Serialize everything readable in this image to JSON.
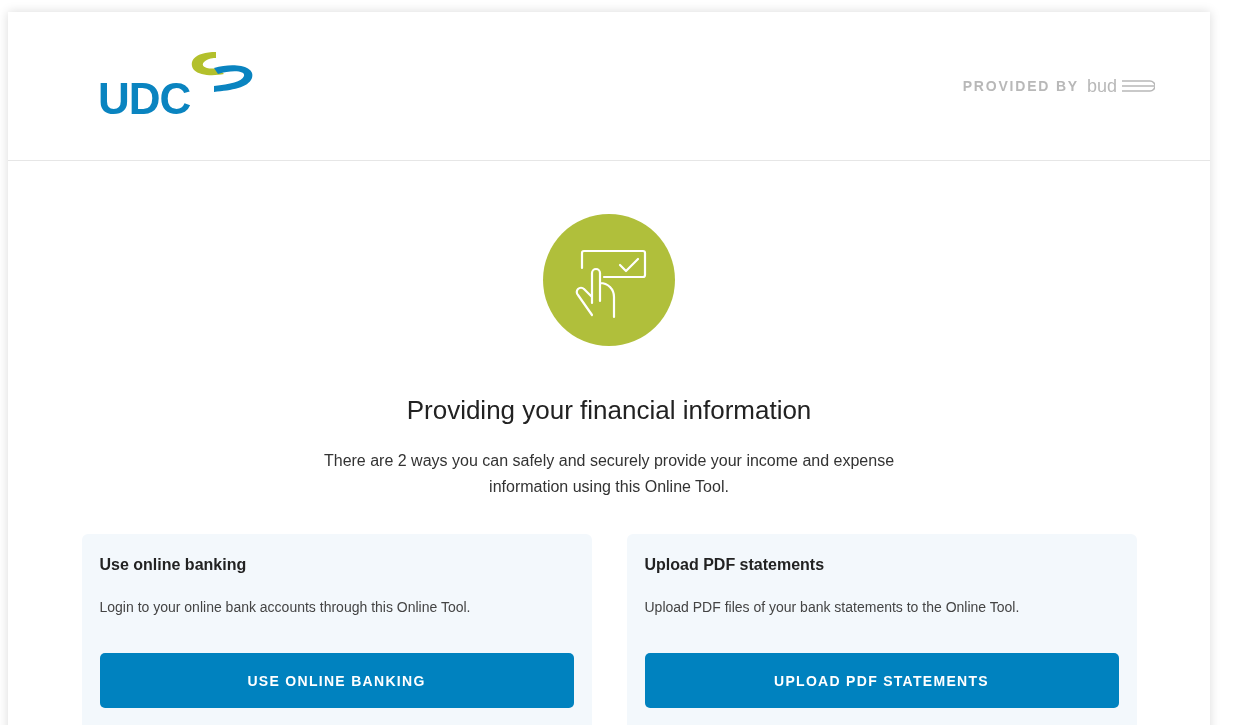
{
  "header": {
    "logo": "UDC",
    "provided_by": "PROVIDED BY",
    "provider": "bud"
  },
  "heading": "Providing your financial information",
  "intro": "There are 2 ways you can safely and securely provide your income and expense information using this Online Tool.",
  "options": [
    {
      "title": "Use online banking",
      "description": "Login to your online bank accounts through this Online Tool.",
      "button": "USE ONLINE BANKING"
    },
    {
      "title": "Upload PDF statements",
      "description": "Upload PDF files of your bank statements to the Online Tool.",
      "button": "UPLOAD PDF STATEMENTS"
    }
  ]
}
